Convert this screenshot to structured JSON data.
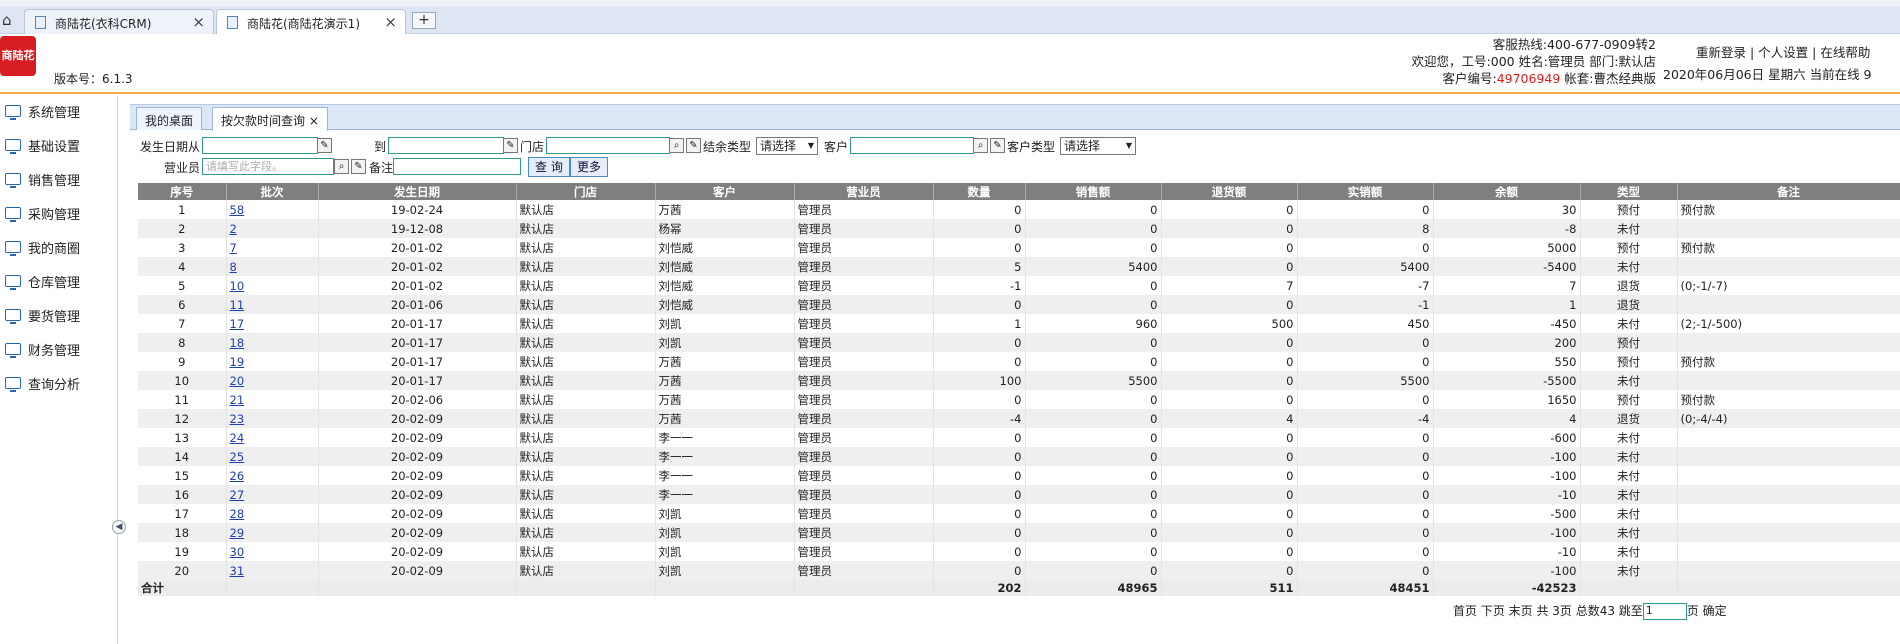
{
  "browser": {
    "tabs": [
      {
        "title": "商陆花(衣科CRM)",
        "close": "×"
      },
      {
        "title": "商陆花(商陆花演示1)",
        "close": "×"
      }
    ],
    "new_tab": "+"
  },
  "header": {
    "logo_text": "商陆花",
    "version": "版本号：6.1.3",
    "hotline": "客服热线:400-677-0909转2",
    "welcome": "欢迎您，工号:000 姓名:管理员 部门:默认店",
    "customer_prefix": "客户编号:",
    "customer_no": "49706949",
    "account_set": " 帐套:曹杰经典版",
    "links": "重新登录 | 个人设置 | 在线帮助",
    "date_line": "2020年06月06日 星期六 当前在线 9",
    "accent_color": "#f1a64a",
    "red_color": "#e21b1b"
  },
  "sidebar": {
    "items": [
      "系统管理",
      "基础设置",
      "销售管理",
      "采购管理",
      "我的商圈",
      "仓库管理",
      "要货管理",
      "财务管理",
      "查询分析"
    ]
  },
  "main_tabs": {
    "desk": "我的桌面",
    "query": "按欠款时间查询",
    "close": "×"
  },
  "filters": {
    "date_from": "发生日期从",
    "date_to": "到",
    "store": "门店",
    "balance_type": "结余类型",
    "balance_type_value": "请选择",
    "customer": "客户",
    "customer_type": "客户类型",
    "customer_type_value": "请选择",
    "salesperson": "营业员",
    "salesperson_placeholder": "请填写此字段。",
    "remark": "备注",
    "query_btn": "查 询",
    "more_btn": "更多"
  },
  "table": {
    "headers": [
      "序号",
      "批次",
      "发生日期",
      "门店",
      "客户",
      "营业员",
      "数量",
      "销售额",
      "退货额",
      "实销额",
      "余额",
      "类型",
      "备注"
    ],
    "rows": [
      [
        "1",
        "58",
        "19-02-24",
        "默认店",
        "万茜",
        "管理员",
        "0",
        "0",
        "0",
        "0",
        "30",
        "预付",
        "预付款"
      ],
      [
        "2",
        "2",
        "19-12-08",
        "默认店",
        "杨幂",
        "管理员",
        "0",
        "0",
        "0",
        "8",
        "-8",
        "未付",
        ""
      ],
      [
        "3",
        "7",
        "20-01-02",
        "默认店",
        "刘恺威",
        "管理员",
        "0",
        "0",
        "0",
        "0",
        "5000",
        "预付",
        "预付款"
      ],
      [
        "4",
        "8",
        "20-01-02",
        "默认店",
        "刘恺威",
        "管理员",
        "5",
        "5400",
        "0",
        "5400",
        "-5400",
        "未付",
        ""
      ],
      [
        "5",
        "10",
        "20-01-02",
        "默认店",
        "刘恺威",
        "管理员",
        "-1",
        "0",
        "7",
        "-7",
        "7",
        "退货",
        "(0;-1/-7)"
      ],
      [
        "6",
        "11",
        "20-01-06",
        "默认店",
        "刘恺威",
        "管理员",
        "0",
        "0",
        "0",
        "-1",
        "1",
        "退货",
        ""
      ],
      [
        "7",
        "17",
        "20-01-17",
        "默认店",
        "刘凯",
        "管理员",
        "1",
        "960",
        "500",
        "450",
        "-450",
        "未付",
        "(2;-1/-500)"
      ],
      [
        "8",
        "18",
        "20-01-17",
        "默认店",
        "刘凯",
        "管理员",
        "0",
        "0",
        "0",
        "0",
        "200",
        "预付",
        ""
      ],
      [
        "9",
        "19",
        "20-01-17",
        "默认店",
        "万茜",
        "管理员",
        "0",
        "0",
        "0",
        "0",
        "550",
        "预付",
        "预付款"
      ],
      [
        "10",
        "20",
        "20-01-17",
        "默认店",
        "万茜",
        "管理员",
        "100",
        "5500",
        "0",
        "5500",
        "-5500",
        "未付",
        ""
      ],
      [
        "11",
        "21",
        "20-02-06",
        "默认店",
        "万茜",
        "管理员",
        "0",
        "0",
        "0",
        "0",
        "1650",
        "预付",
        "预付款"
      ],
      [
        "12",
        "23",
        "20-02-09",
        "默认店",
        "万茜",
        "管理员",
        "-4",
        "0",
        "4",
        "-4",
        "4",
        "退货",
        "(0;-4/-4)"
      ],
      [
        "13",
        "24",
        "20-02-09",
        "默认店",
        "李一一",
        "管理员",
        "0",
        "0",
        "0",
        "0",
        "-600",
        "未付",
        ""
      ],
      [
        "14",
        "25",
        "20-02-09",
        "默认店",
        "李一一",
        "管理员",
        "0",
        "0",
        "0",
        "0",
        "-100",
        "未付",
        ""
      ],
      [
        "15",
        "26",
        "20-02-09",
        "默认店",
        "李一一",
        "管理员",
        "0",
        "0",
        "0",
        "0",
        "-100",
        "未付",
        ""
      ],
      [
        "16",
        "27",
        "20-02-09",
        "默认店",
        "李一一",
        "管理员",
        "0",
        "0",
        "0",
        "0",
        "-10",
        "未付",
        ""
      ],
      [
        "17",
        "28",
        "20-02-09",
        "默认店",
        "刘凯",
        "管理员",
        "0",
        "0",
        "0",
        "0",
        "-500",
        "未付",
        ""
      ],
      [
        "18",
        "29",
        "20-02-09",
        "默认店",
        "刘凯",
        "管理员",
        "0",
        "0",
        "0",
        "0",
        "-100",
        "未付",
        ""
      ],
      [
        "19",
        "30",
        "20-02-09",
        "默认店",
        "刘凯",
        "管理员",
        "0",
        "0",
        "0",
        "0",
        "-10",
        "未付",
        ""
      ],
      [
        "20",
        "31",
        "20-02-09",
        "默认店",
        "刘凯",
        "管理员",
        "0",
        "0",
        "0",
        "0",
        "-100",
        "未付",
        ""
      ]
    ],
    "total_label": "合计",
    "totals": {
      "qty": "202",
      "sales": "48965",
      "returns": "511",
      "net": "48451",
      "balance": "-42523"
    }
  },
  "pager": {
    "text": "首页 下页 末页 共 3页 总数43 跳至",
    "page_value": "1",
    "suffix": "页 确定"
  }
}
